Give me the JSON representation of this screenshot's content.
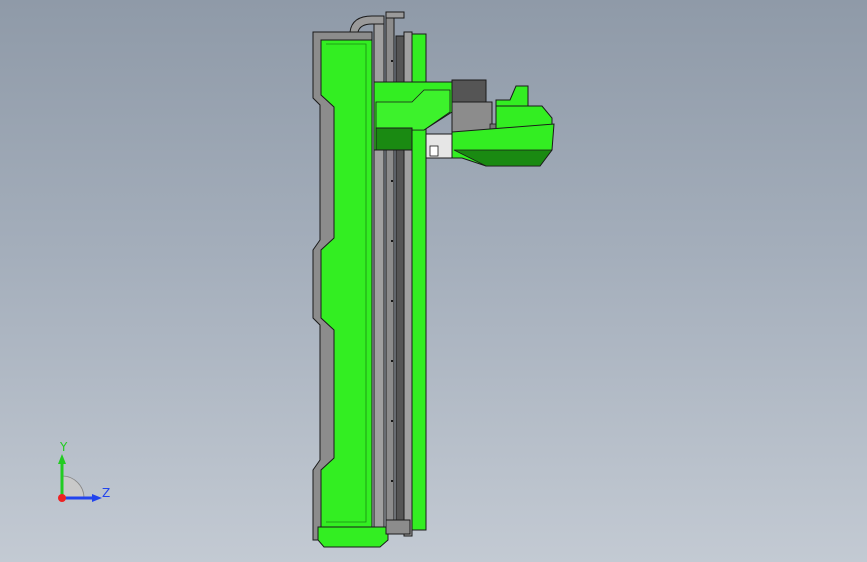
{
  "colors": {
    "background_top": "#8f9aa8",
    "background_bottom": "#c3cad3",
    "part_green": "#33ee22",
    "part_dark_green": "#1a8a12",
    "frame_gray": "#8c8c8c",
    "dark_gray": "#555555",
    "edge": "#1a1a1a"
  },
  "triad": {
    "y_label": "Y",
    "z_label": "Z",
    "y_color": "#22cc22",
    "z_color": "#2244ee",
    "x_color": "#ee2222",
    "icon": "coordinate-triad-icon"
  }
}
